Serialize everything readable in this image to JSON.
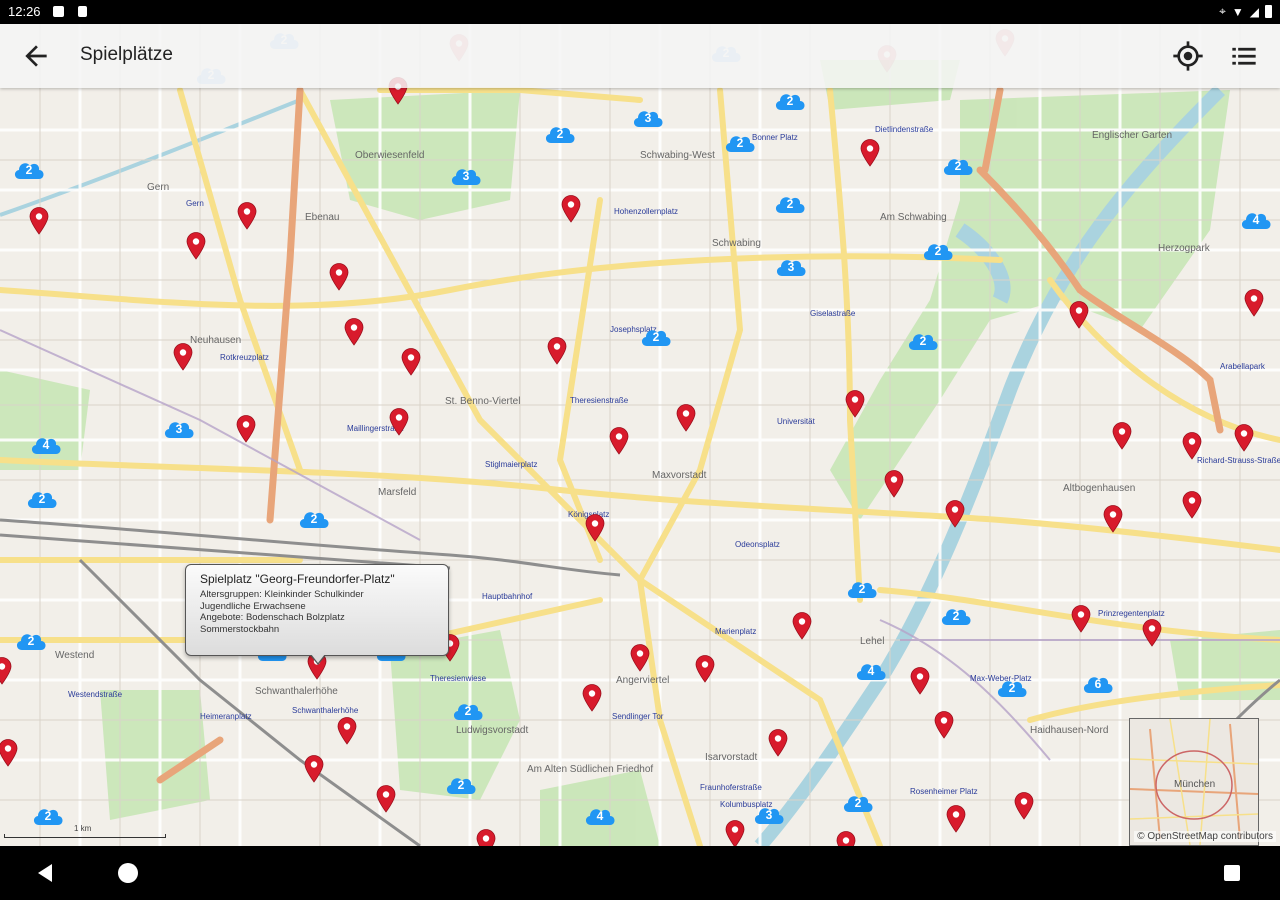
{
  "status_bar": {
    "time": "12:26"
  },
  "app_bar": {
    "title": "Spielplätze",
    "back_icon": "arrow-back-icon",
    "locate_icon": "my-location-icon",
    "list_icon": "list-icon"
  },
  "map": {
    "place_labels": [
      "Oberwiesenfeld",
      "Gern",
      "Ebenau",
      "Neuhausen",
      "Schwabing",
      "Schwabing-West",
      "Am Schwabing",
      "Herzogpark",
      "Englischer Garten",
      "St. Benno-Viertel",
      "Maxvorstadt",
      "Marsfeld",
      "Altbogenhausen",
      "Westend",
      "Schwanthalerhöhe",
      "Ludwigsvorstadt",
      "Am Alten Südlichen Friedhof",
      "Lehel",
      "Haidhausen-Nord",
      "Angerviertel",
      "Isarvorstadt",
      "München"
    ],
    "station_labels": [
      "Gern",
      "Rotkreuzplatz",
      "Maillingerstraße",
      "Stiglmaierplatz",
      "Königsplatz",
      "Theresienstraße",
      "Universität",
      "Josephsplatz",
      "Hohenzollernplatz",
      "Dietlindenstraße",
      "Bonner Platz",
      "Giselastraße",
      "Odeonsplatz",
      "Marienplatz",
      "Hauptbahnhof",
      "Theresienwiese",
      "Heimeranplatz",
      "Westendstraße",
      "Schwanthalerhöhe",
      "Sendlinger Tor",
      "Fraunhoferstraße",
      "Kolumbusplatz",
      "Max-Weber-Platz",
      "Richard-Strauss-Straße",
      "Arabellapark",
      "Prinzregentenplatz",
      "Rosenheimer Platz"
    ],
    "attribution": "© OpenStreetMap contributors",
    "scale_label": "1 km",
    "overview_label": "München"
  },
  "popup": {
    "title": "Spielplatz \"Georg-Freundorfer-Platz\"",
    "lines": [
      "Altersgruppen: Kleinkinder Schulkinder",
      "Jugendliche Erwachsene",
      "Angebote: Bodenschach Bolzplatz",
      "Sommerstockbahn"
    ]
  },
  "clusters": [
    {
      "count": "2",
      "pos": [
        284,
        39
      ],
      "faded": true
    },
    {
      "count": "2",
      "pos": [
        211,
        74
      ],
      "faded": true
    },
    {
      "count": "2",
      "pos": [
        726,
        52
      ],
      "faded": true
    },
    {
      "count": "2",
      "pos": [
        790,
        100
      ]
    },
    {
      "count": "2",
      "pos": [
        560,
        133
      ]
    },
    {
      "count": "3",
      "pos": [
        648,
        117
      ]
    },
    {
      "count": "2",
      "pos": [
        740,
        142
      ]
    },
    {
      "count": "2",
      "pos": [
        29,
        169
      ]
    },
    {
      "count": "3",
      "pos": [
        466,
        175
      ]
    },
    {
      "count": "2",
      "pos": [
        790,
        203
      ]
    },
    {
      "count": "2",
      "pos": [
        958,
        165
      ]
    },
    {
      "count": "4",
      "pos": [
        1256,
        219
      ]
    },
    {
      "count": "2",
      "pos": [
        938,
        250
      ]
    },
    {
      "count": "3",
      "pos": [
        791,
        266
      ]
    },
    {
      "count": "2",
      "pos": [
        656,
        336
      ]
    },
    {
      "count": "2",
      "pos": [
        923,
        340
      ]
    },
    {
      "count": "3",
      "pos": [
        179,
        428
      ]
    },
    {
      "count": "4",
      "pos": [
        46,
        444
      ]
    },
    {
      "count": "2",
      "pos": [
        42,
        498
      ]
    },
    {
      "count": "2",
      "pos": [
        314,
        518
      ]
    },
    {
      "count": "2",
      "pos": [
        862,
        588
      ]
    },
    {
      "count": "2",
      "pos": [
        956,
        615
      ]
    },
    {
      "count": "2",
      "pos": [
        31,
        640
      ]
    },
    {
      "count": "3",
      "pos": [
        272,
        651
      ]
    },
    {
      "count": "4",
      "pos": [
        391,
        651
      ]
    },
    {
      "count": "4",
      "pos": [
        871,
        670
      ]
    },
    {
      "count": "2",
      "pos": [
        1012,
        687
      ]
    },
    {
      "count": "6",
      "pos": [
        1098,
        683
      ]
    },
    {
      "count": "2",
      "pos": [
        468,
        710
      ]
    },
    {
      "count": "2",
      "pos": [
        461,
        784
      ]
    },
    {
      "count": "2",
      "pos": [
        48,
        815
      ]
    },
    {
      "count": "4",
      "pos": [
        600,
        815
      ]
    },
    {
      "count": "3",
      "pos": [
        769,
        814
      ]
    },
    {
      "count": "2",
      "pos": [
        858,
        802
      ]
    }
  ],
  "pins": [
    [
      459,
      47,
      true
    ],
    [
      887,
      58,
      true
    ],
    [
      1005,
      42,
      true
    ],
    [
      398,
      90,
      false
    ],
    [
      870,
      152
    ],
    [
      571,
      208
    ],
    [
      39,
      220
    ],
    [
      247,
      215
    ],
    [
      196,
      245
    ],
    [
      339,
      276
    ],
    [
      354,
      331
    ],
    [
      1079,
      314
    ],
    [
      1254,
      302
    ],
    [
      183,
      356
    ],
    [
      411,
      361
    ],
    [
      557,
      350
    ],
    [
      855,
      403
    ],
    [
      686,
      417
    ],
    [
      246,
      428
    ],
    [
      399,
      421
    ],
    [
      619,
      440
    ],
    [
      1122,
      435
    ],
    [
      1192,
      445
    ],
    [
      1244,
      437
    ],
    [
      894,
      483
    ],
    [
      1192,
      504
    ],
    [
      955,
      513
    ],
    [
      1113,
      518
    ],
    [
      595,
      527
    ],
    [
      1081,
      618
    ],
    [
      1152,
      632
    ],
    [
      802,
      625
    ],
    [
      450,
      647
    ],
    [
      640,
      657
    ],
    [
      705,
      668
    ],
    [
      317,
      665
    ],
    [
      2,
      670
    ],
    [
      920,
      680
    ],
    [
      592,
      697
    ],
    [
      944,
      724
    ],
    [
      347,
      730
    ],
    [
      778,
      742
    ],
    [
      8,
      752
    ],
    [
      314,
      768
    ],
    [
      386,
      798
    ],
    [
      1024,
      805
    ],
    [
      956,
      818
    ],
    [
      735,
      833
    ],
    [
      486,
      842
    ],
    [
      846,
      844
    ]
  ]
}
